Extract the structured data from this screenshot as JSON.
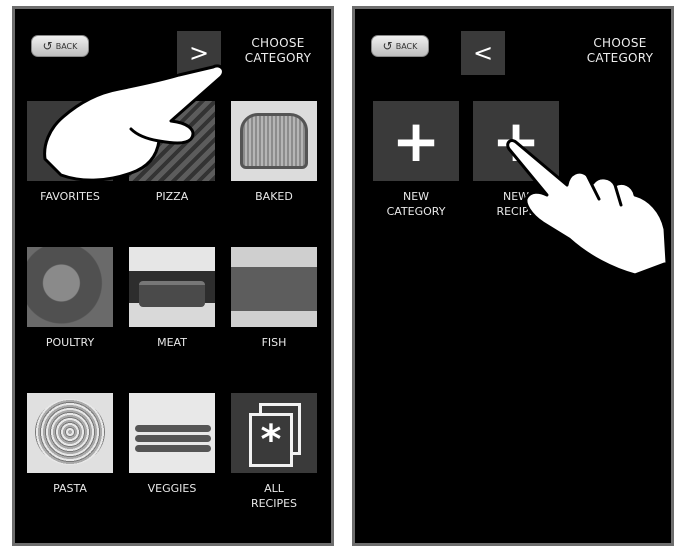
{
  "left_screen": {
    "back_label": "BACK",
    "nav_arrow": ">",
    "title": "CHOOSE CATEGORY",
    "tiles": [
      {
        "label": "FAVORITES",
        "icon": "favorites-photo"
      },
      {
        "label": "PIZZA",
        "icon": "pizza-photo"
      },
      {
        "label": "BAKED",
        "icon": "bread-photo"
      },
      {
        "label": "POULTRY",
        "icon": "poultry-photo"
      },
      {
        "label": "MEAT",
        "icon": "meat-photo"
      },
      {
        "label": "FISH",
        "icon": "fish-photo"
      },
      {
        "label": "PASTA",
        "icon": "pasta-photo"
      },
      {
        "label": "VEGGIES",
        "icon": "asparagus-photo"
      },
      {
        "label": "ALL RECIPES",
        "icon": "asterisk-cards-icon"
      }
    ]
  },
  "right_screen": {
    "back_label": "BACK",
    "nav_arrow": "<",
    "title": "CHOOSE CATEGORY",
    "tiles": [
      {
        "label": "NEW CATEGORY",
        "icon": "plus-icon"
      },
      {
        "label": "NEW RECIPE",
        "icon": "plus-icon"
      }
    ]
  },
  "colors": {
    "screen_background": "#000000",
    "tile_background": "#3a3a3a",
    "bezel": "#6e6e6e",
    "text": "#e8e8e8"
  },
  "icons": {
    "back": "circular-arrow-icon",
    "pointer": "pointing-hand-icon",
    "asterisk": "*",
    "plus": "+"
  }
}
